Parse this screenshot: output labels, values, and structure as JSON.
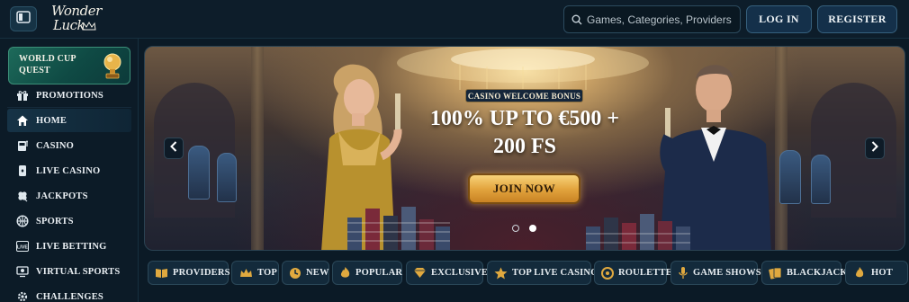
{
  "header": {
    "logo_line1": "Wonder",
    "logo_line2": "Luck",
    "search_placeholder": "Games, Categories, Providers",
    "login_label": "LOG IN",
    "register_label": "REGISTER"
  },
  "sidebar": {
    "promo_title": "WORLD CUP QUEST",
    "items": [
      {
        "label": "PROMOTIONS",
        "icon": "gift-icon"
      },
      {
        "label": "HOME",
        "icon": "home-icon",
        "active": true
      },
      {
        "label": "CASINO",
        "icon": "slot-machine-icon"
      },
      {
        "label": "LIVE CASINO",
        "icon": "cards-icon"
      },
      {
        "label": "JACKPOTS",
        "icon": "clover-icon"
      },
      {
        "label": "SPORTS",
        "icon": "basketball-icon"
      },
      {
        "label": "LIVE BETTING",
        "icon": "live-icon"
      },
      {
        "label": "VIRTUAL SPORTS",
        "icon": "monitor-icon"
      },
      {
        "label": "CHALLENGES",
        "icon": "gear-icon"
      }
    ]
  },
  "banner": {
    "badge": "CASINO WELCOME BONUS",
    "headline_line1": "100% UP TO €500 +",
    "headline_line2": "200 FS",
    "cta_label": "JOIN NOW",
    "slide_count": 2,
    "active_slide": 2
  },
  "categories": [
    {
      "label": "PROVIDERS",
      "icon": "book-icon"
    },
    {
      "label": "TOP",
      "icon": "crown-icon"
    },
    {
      "label": "NEW",
      "icon": "clock-icon"
    },
    {
      "label": "POPULAR",
      "icon": "flame-icon"
    },
    {
      "label": "EXCLUSIVE",
      "icon": "diamond-icon"
    },
    {
      "label": "TOP LIVE CASINO",
      "icon": "star-icon"
    },
    {
      "label": "ROULETTE",
      "icon": "roulette-icon"
    },
    {
      "label": "GAME SHOWS",
      "icon": "microphone-icon"
    },
    {
      "label": "BLACKJACK",
      "icon": "blackjack-icon"
    },
    {
      "label": "HOT",
      "icon": "hot-icon"
    }
  ],
  "colors": {
    "background": "#0b1a26",
    "accent_gold": "#e3a53f",
    "promo_green": "#1d6a5a"
  }
}
